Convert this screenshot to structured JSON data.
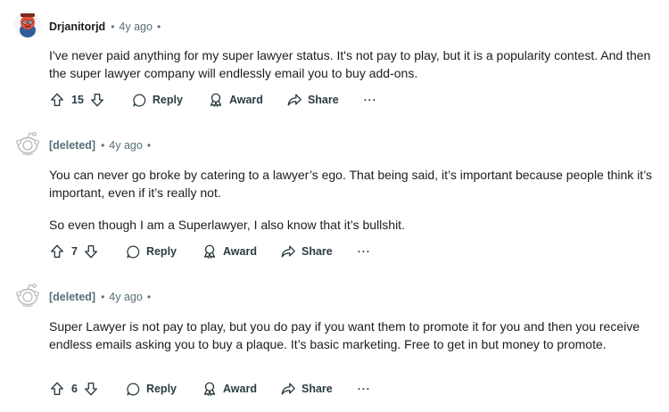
{
  "comments": [
    {
      "username": "Drjanitorjd",
      "separator": "•",
      "timestamp": "4y ago",
      "trailing_dot": "•",
      "paragraphs": [
        "I've never paid anything for my super lawyer status. It's not pay to play, but it is a popularity contest. And then the super lawyer company will endlessly email you to buy add-ons."
      ],
      "score": "15",
      "reply_label": "Reply",
      "award_label": "Award",
      "share_label": "Share",
      "more_label": "···"
    },
    {
      "username": "[deleted]",
      "separator": "•",
      "timestamp": "4y ago",
      "trailing_dot": "•",
      "paragraphs": [
        "You can never go broke by catering to a lawyer’s ego. That being said, it’s important because people think it’s important, even if it’s really not.",
        "So even though I am a Superlawyer, I also know that it’s bullshit."
      ],
      "score": "7",
      "reply_label": "Reply",
      "award_label": "Award",
      "share_label": "Share",
      "more_label": "···"
    },
    {
      "username": "[deleted]",
      "separator": "•",
      "timestamp": "4y ago",
      "trailing_dot": "•",
      "paragraphs": [
        "Super Lawyer is not pay to play, but you do pay if you want them to promote it for you and then you receive endless emails asking you to buy a plaque. It’s basic marketing. Free to get in but money to promote."
      ],
      "score": "6",
      "reply_label": "Reply",
      "award_label": "Award",
      "share_label": "Share",
      "more_label": "···"
    }
  ],
  "icons": {
    "upvote": "arrow-up-outline-icon",
    "downvote": "arrow-down-outline-icon",
    "reply": "speech-bubble-icon",
    "award": "award-ribbon-icon",
    "share": "share-arrow-icon",
    "avatar_user": "snoo-avatar-red",
    "avatar_deleted": "snoo-avatar-gray"
  },
  "colors": {
    "text": "#1c1c1c",
    "meta": "#576f76",
    "action": "#2a3c42",
    "avatar_red": "#e4503a",
    "avatar_gray": "#c8ccce"
  }
}
